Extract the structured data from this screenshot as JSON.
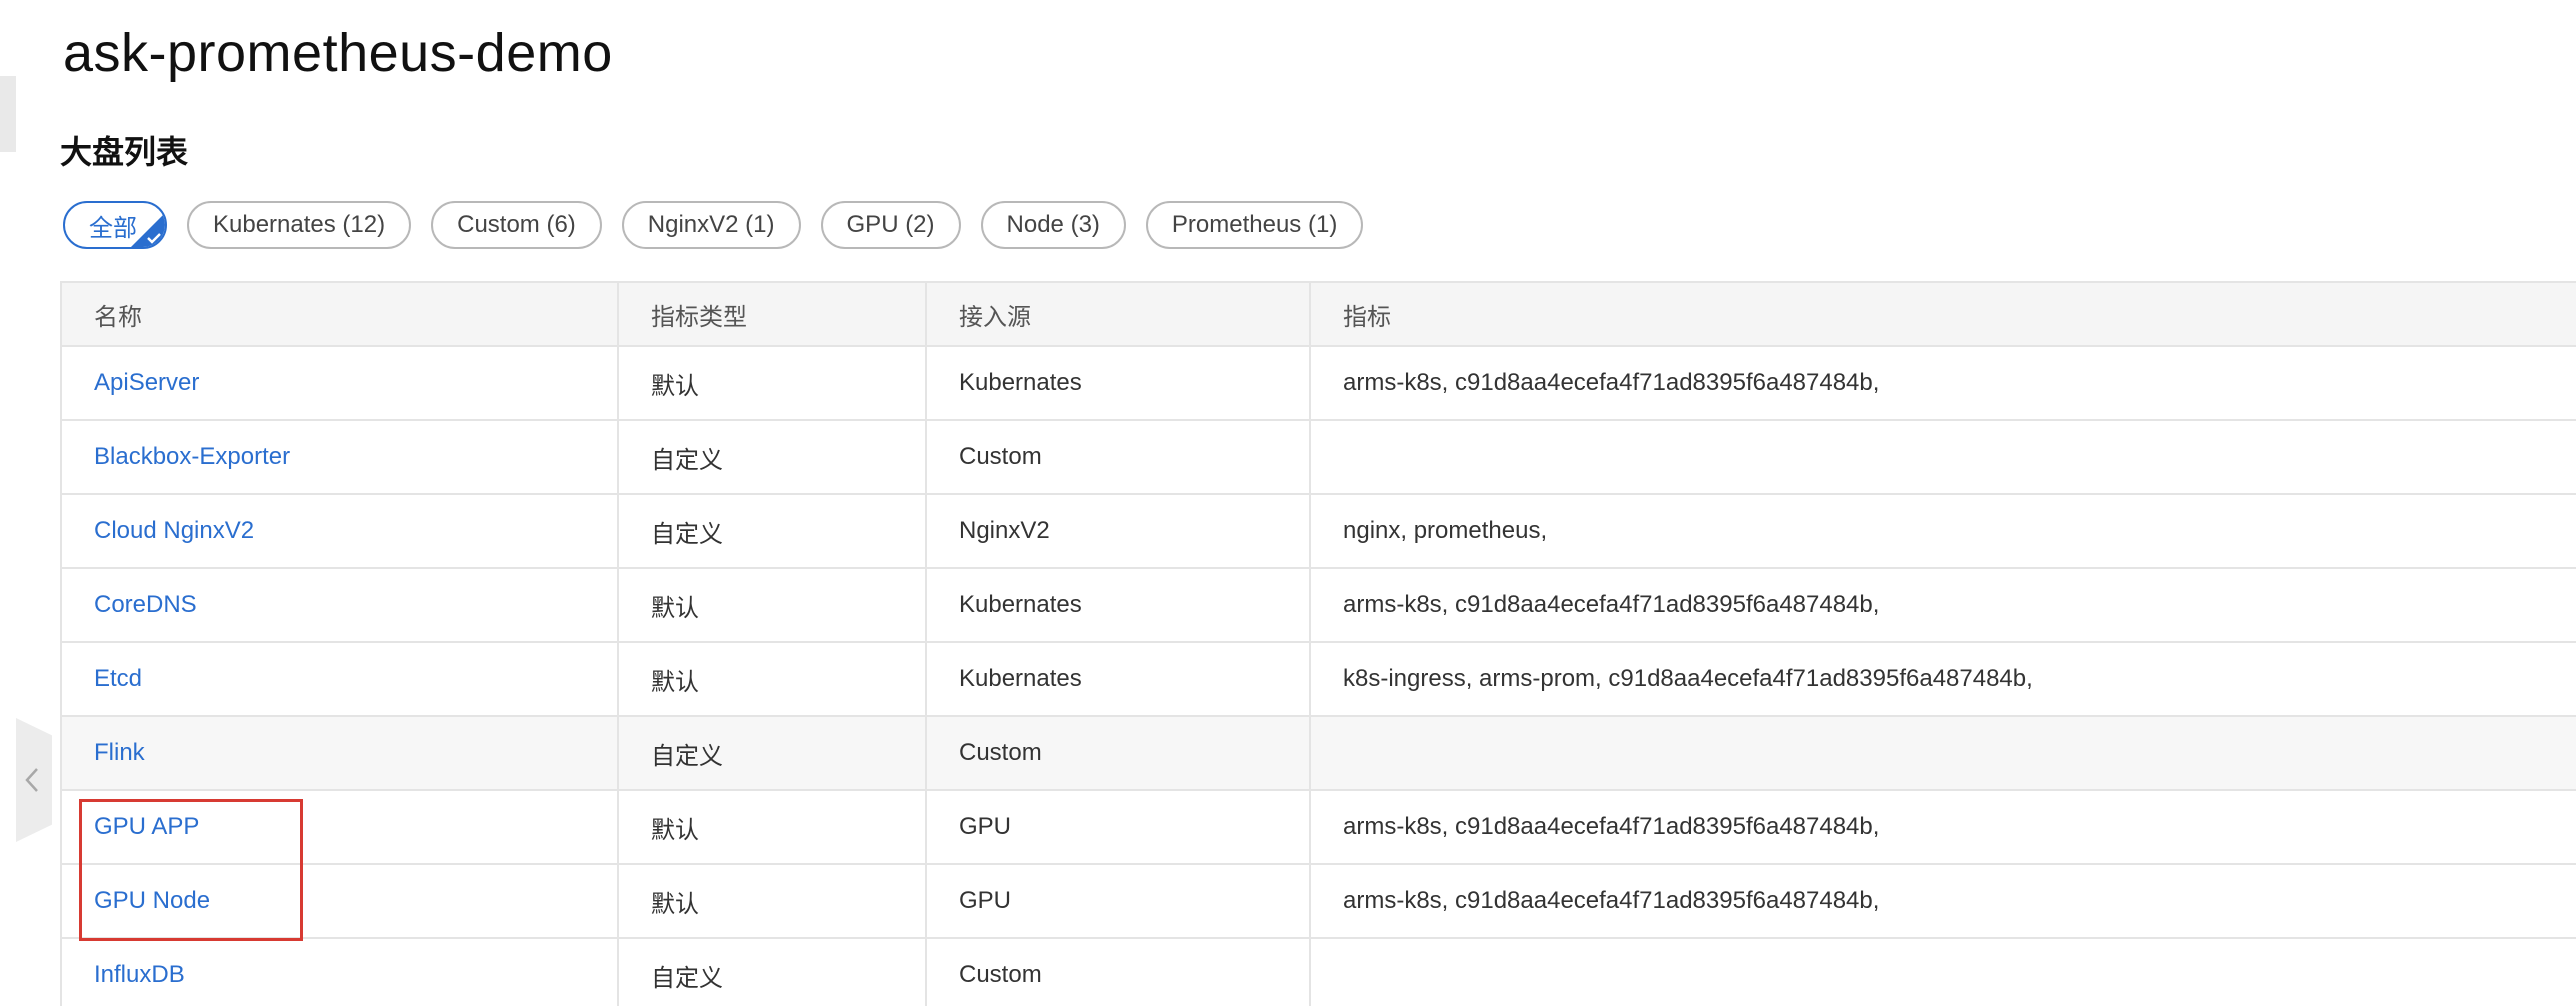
{
  "page": {
    "title": "ask-prometheus-demo"
  },
  "section": {
    "title": "大盘列表"
  },
  "filters": [
    {
      "label": "全部",
      "active": true
    },
    {
      "label": "Kubernates (12)",
      "active": false
    },
    {
      "label": "Custom (6)",
      "active": false
    },
    {
      "label": "NginxV2 (1)",
      "active": false
    },
    {
      "label": "GPU (2)",
      "active": false
    },
    {
      "label": "Node (3)",
      "active": false
    },
    {
      "label": "Prometheus (1)",
      "active": false
    }
  ],
  "table": {
    "headers": {
      "name": "名称",
      "type": "指标类型",
      "source": "接入源",
      "metrics": "指标"
    },
    "rows": [
      {
        "name": "ApiServer",
        "type": "默认",
        "source": "Kubernates",
        "metrics": "arms-k8s, c91d8aa4ecefa4f71ad8395f6a487484b,"
      },
      {
        "name": "Blackbox-Exporter",
        "type": "自定义",
        "source": "Custom",
        "metrics": ""
      },
      {
        "name": "Cloud NginxV2",
        "type": "自定义",
        "source": "NginxV2",
        "metrics": "nginx, prometheus,"
      },
      {
        "name": "CoreDNS",
        "type": "默认",
        "source": "Kubernates",
        "metrics": "arms-k8s, c91d8aa4ecefa4f71ad8395f6a487484b,"
      },
      {
        "name": "Etcd",
        "type": "默认",
        "source": "Kubernates",
        "metrics": "k8s-ingress, arms-prom, c91d8aa4ecefa4f71ad8395f6a487484b,"
      },
      {
        "name": "Flink",
        "type": "自定义",
        "source": "Custom",
        "metrics": ""
      },
      {
        "name": "GPU APP",
        "type": "默认",
        "source": "GPU",
        "metrics": "arms-k8s, c91d8aa4ecefa4f71ad8395f6a487484b,"
      },
      {
        "name": "GPU Node",
        "type": "默认",
        "source": "GPU",
        "metrics": "arms-k8s, c91d8aa4ecefa4f71ad8395f6a487484b,"
      },
      {
        "name": "InfluxDB",
        "type": "自定义",
        "source": "Custom",
        "metrics": ""
      }
    ]
  },
  "colors": {
    "accent": "#2a6ecf",
    "annotation": "#d73a32",
    "header_bg": "#f5f5f5",
    "border": "#e4e4e4"
  }
}
